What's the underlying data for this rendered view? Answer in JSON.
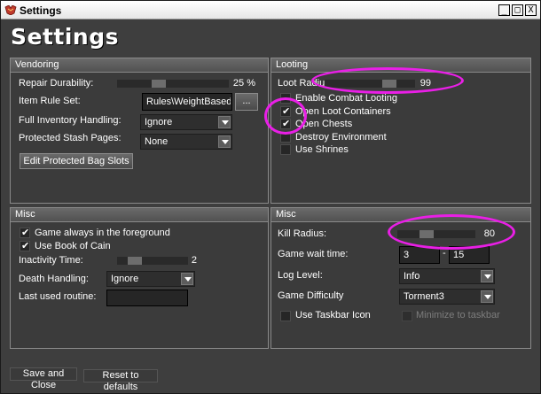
{
  "window": {
    "title": "Settings",
    "min": "_",
    "max": "□",
    "close": "X"
  },
  "header": {
    "title": "Settings"
  },
  "vendoring": {
    "title": "Vendoring",
    "repair_label": "Repair Durability:",
    "repair_value": "25 %",
    "repair_fraction": 0.35,
    "item_rule_label": "Item Rule Set:",
    "item_rule_value": "Rules\\WeightBasedRules",
    "browse_label": "...",
    "full_inv_label": "Full Inventory Handling:",
    "full_inv_value": "Ignore",
    "stash_label": "Protected Stash Pages:",
    "stash_value": "None",
    "edit_bag_label": "Edit Protected Bag Slots"
  },
  "looting": {
    "title": "Looting",
    "loot_radius_label": "Loot Radius:",
    "loot_radius_value": "99",
    "loot_radius_fraction": 0.75,
    "options": [
      {
        "label": "Enable Combat Looting",
        "checked": false
      },
      {
        "label": "Open Loot Containers",
        "checked": true
      },
      {
        "label": "Open Chests",
        "checked": true
      },
      {
        "label": "Destroy Environment",
        "checked": false
      },
      {
        "label": "Use Shrines",
        "checked": false
      }
    ]
  },
  "misc_left": {
    "title": "Misc",
    "foreground_label": "Game always in the foreground",
    "foreground_checked": true,
    "cain_label": "Use Book of Cain",
    "cain_checked": true,
    "inactivity_label": "Inactivity Time:",
    "inactivity_value": "2",
    "inactivity_fraction": 0.18,
    "death_label": "Death Handling:",
    "death_value": "Ignore",
    "last_routine_label": "Last used routine:",
    "last_routine_value": ""
  },
  "misc_right": {
    "title": "Misc",
    "kill_radius_label": "Kill Radius:",
    "kill_radius_value": "80",
    "kill_radius_fraction": 0.35,
    "wait_label": "Game wait time:",
    "wait_min": "3",
    "wait_sep": "-",
    "wait_max": "15",
    "log_label": "Log Level:",
    "log_value": "Info",
    "difficulty_label": "Game Difficulty",
    "difficulty_value": "Torment3",
    "taskbar_icon_label": "Use Taskbar Icon",
    "taskbar_icon_checked": false,
    "minimize_label": "Minimize to taskbar",
    "minimize_checked": false
  },
  "footer": {
    "save_label": "Save and Close",
    "reset_label": "Reset to defaults"
  },
  "colors": {
    "annotation": "#e91fe6",
    "window_bg": "#3e3e3e",
    "panel_header": "#5e5e5e"
  }
}
